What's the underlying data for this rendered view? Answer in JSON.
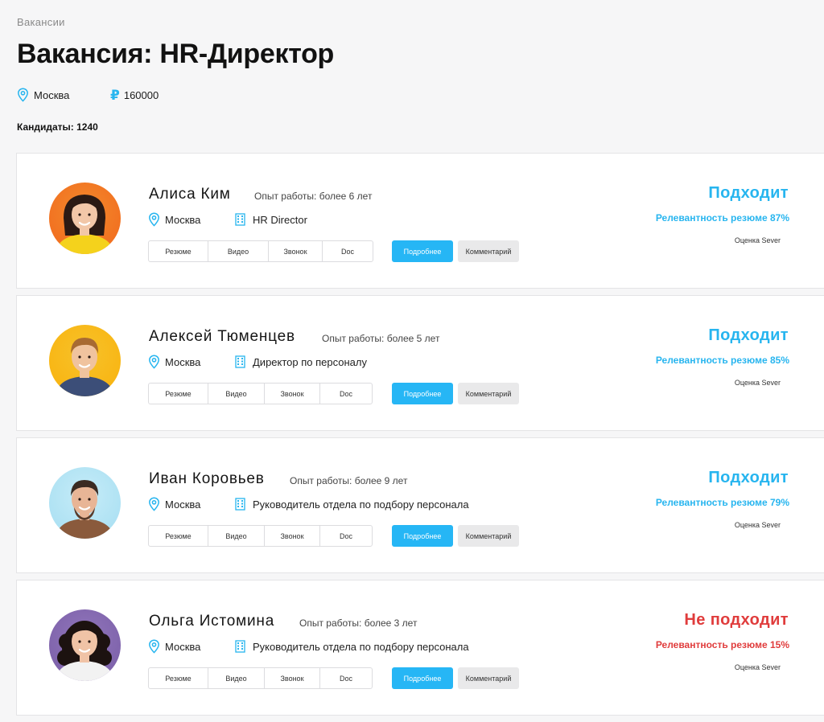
{
  "breadcrumb": "Вакансии",
  "title": "Вакансия: HR-Директор",
  "vacancy": {
    "city": "Москва",
    "salary": "160000",
    "currency_icon": "ruble-icon"
  },
  "candidates_label": "Кандидаты: 1240",
  "colors": {
    "accent": "#27b5ef",
    "danger": "#e03c3c",
    "button_primary": "#26b6f5"
  },
  "tabs": [
    "Резюме",
    "Видео",
    "Звонок",
    "Doc"
  ],
  "buttons": {
    "more": "Подробнее",
    "comment": "Комментарий"
  },
  "rating_label": "Оценка Sever",
  "candidates": [
    {
      "name": "Алиса Ким",
      "experience": "Опыт работы: более 6 лет",
      "city": "Москва",
      "position": "HR Director",
      "verdict": "Подходит",
      "relevance": "Релевантность резюме 87%",
      "status": "ok"
    },
    {
      "name": "Алексей Тюменцев",
      "experience": "Опыт работы: более 5 лет",
      "city": "Москва",
      "position": "Директор по персоналу",
      "verdict": "Подходит",
      "relevance": "Релевантность резюме 85%",
      "status": "ok"
    },
    {
      "name": "Иван Коровьев",
      "experience": "Опыт работы: более 9 лет",
      "city": "Москва",
      "position": "Руководитель отдела по подбору персонала",
      "verdict": "Подходит",
      "relevance": "Релевантность резюме 79%",
      "status": "ok"
    },
    {
      "name": "Ольга Истомина",
      "experience": "Опыт работы: более 3 лет",
      "city": "Москва",
      "position": "Руководитель отдела по подбору персонала",
      "verdict": "Не подходит",
      "relevance": "Релевантность резюме 15%",
      "status": "bad"
    }
  ]
}
